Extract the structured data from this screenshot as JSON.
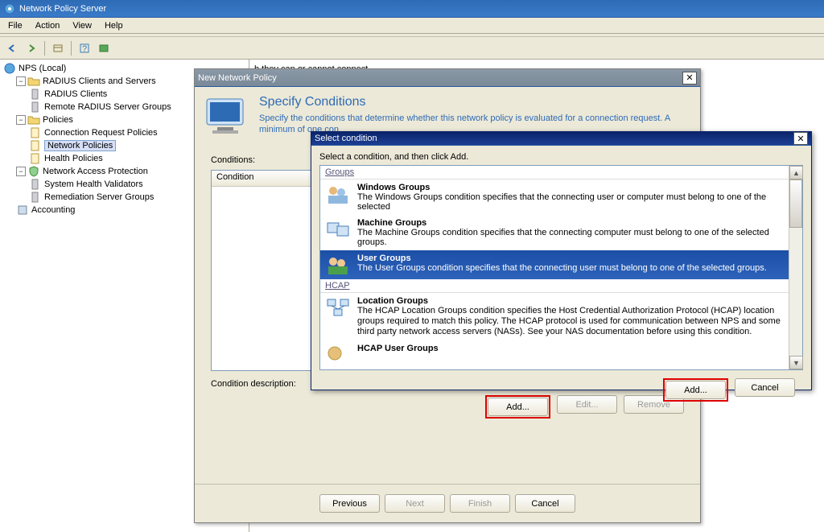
{
  "window": {
    "title": "Network Policy Server"
  },
  "menu": {
    "file": "File",
    "action": "Action",
    "view": "View",
    "help": "Help"
  },
  "tree": {
    "root": "NPS (Local)",
    "radius": "RADIUS Clients and Servers",
    "radius_clients": "RADIUS Clients",
    "remote_groups": "Remote RADIUS Server Groups",
    "policies": "Policies",
    "crp": "Connection Request Policies",
    "np": "Network Policies",
    "hp": "Health Policies",
    "nap": "Network Access Protection",
    "shv": "System Health Validators",
    "rsg": "Remediation Server Groups",
    "accounting": "Accounting"
  },
  "detail_hint": "h they can or cannot connect.",
  "wizard": {
    "title": "New Network Policy",
    "heading": "Specify Conditions",
    "subheading": "Specify the conditions that determine whether this network policy is evaluated for a connection request. A minimum of one con",
    "conditions_label": "Conditions:",
    "condition_col": "Condition",
    "condition_desc": "Condition description:",
    "add": "Add...",
    "edit": "Edit...",
    "remove": "Remove",
    "previous": "Previous",
    "next": "Next",
    "finish": "Finish",
    "cancel": "Cancel"
  },
  "dialog": {
    "title": "Select condition",
    "instruction": "Select a condition, and then click Add.",
    "group_groups": "Groups",
    "group_hcap": "HCAP",
    "items": {
      "wg_title": "Windows Groups",
      "wg_desc": "The Windows Groups condition specifies that the connecting user or computer must belong to one of the selected",
      "mg_title": "Machine Groups",
      "mg_desc": "The Machine Groups condition specifies that the connecting computer must belong to one of the selected groups.",
      "ug_title": "User Groups",
      "ug_desc": "The User Groups condition specifies that the connecting user must belong to one of the selected groups.",
      "lg_title": "Location Groups",
      "lg_desc": "The HCAP Location Groups condition specifies the Host Credential Authorization Protocol (HCAP) location groups required to match this policy. The HCAP protocol is used for communication between NPS and some third party network access servers (NASs). See your NAS documentation before using this condition.",
      "hug_title": "HCAP User Groups"
    },
    "add": "Add...",
    "cancel": "Cancel"
  }
}
